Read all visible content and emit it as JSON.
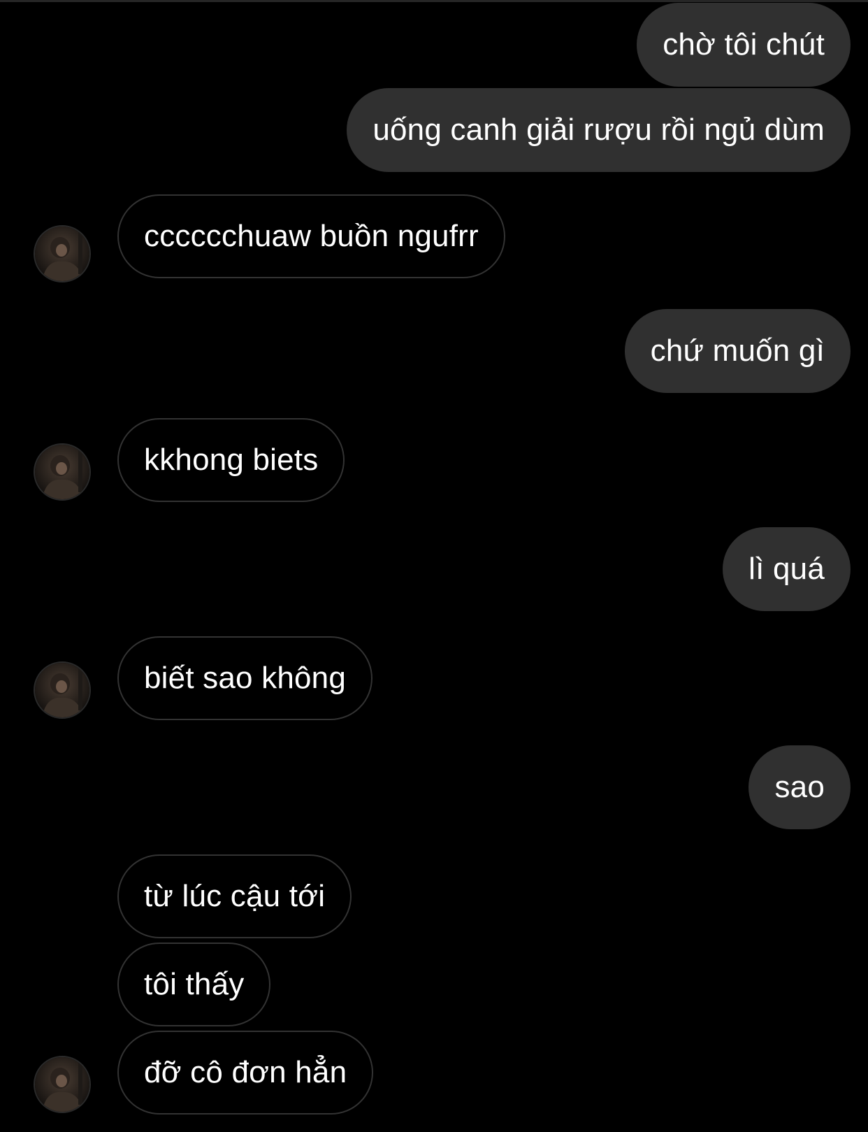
{
  "conversation": {
    "messages": [
      {
        "id": "m1",
        "direction": "outgoing",
        "text": "chờ tôi chút"
      },
      {
        "id": "m2",
        "direction": "outgoing",
        "text": "uống canh giải rượu rồi ngủ dùm"
      },
      {
        "id": "m3",
        "direction": "incoming",
        "text": "cccccchuaw buồn ngufrr",
        "show_avatar": true
      },
      {
        "id": "m4",
        "direction": "outgoing",
        "text": "chứ muốn gì"
      },
      {
        "id": "m5",
        "direction": "incoming",
        "text": "kkhong biets",
        "show_avatar": true
      },
      {
        "id": "m6",
        "direction": "outgoing",
        "text": "lì quá"
      },
      {
        "id": "m7",
        "direction": "incoming",
        "text": "biết sao không",
        "show_avatar": true
      },
      {
        "id": "m8",
        "direction": "outgoing",
        "text": "sao"
      },
      {
        "id": "m9",
        "direction": "incoming",
        "text": "từ lúc cậu tới",
        "show_avatar": false
      },
      {
        "id": "m10",
        "direction": "incoming",
        "text": "tôi thấy",
        "show_avatar": false
      },
      {
        "id": "m11",
        "direction": "incoming",
        "text": "đỡ cô đơn hẳn",
        "show_avatar": true
      }
    ]
  },
  "colors": {
    "background": "#000000",
    "outgoing_bubble": "#303030",
    "incoming_bubble_border": "#333333",
    "text": "#ffffff"
  },
  "icons": {
    "contact_avatar": "contact-avatar-photo"
  }
}
